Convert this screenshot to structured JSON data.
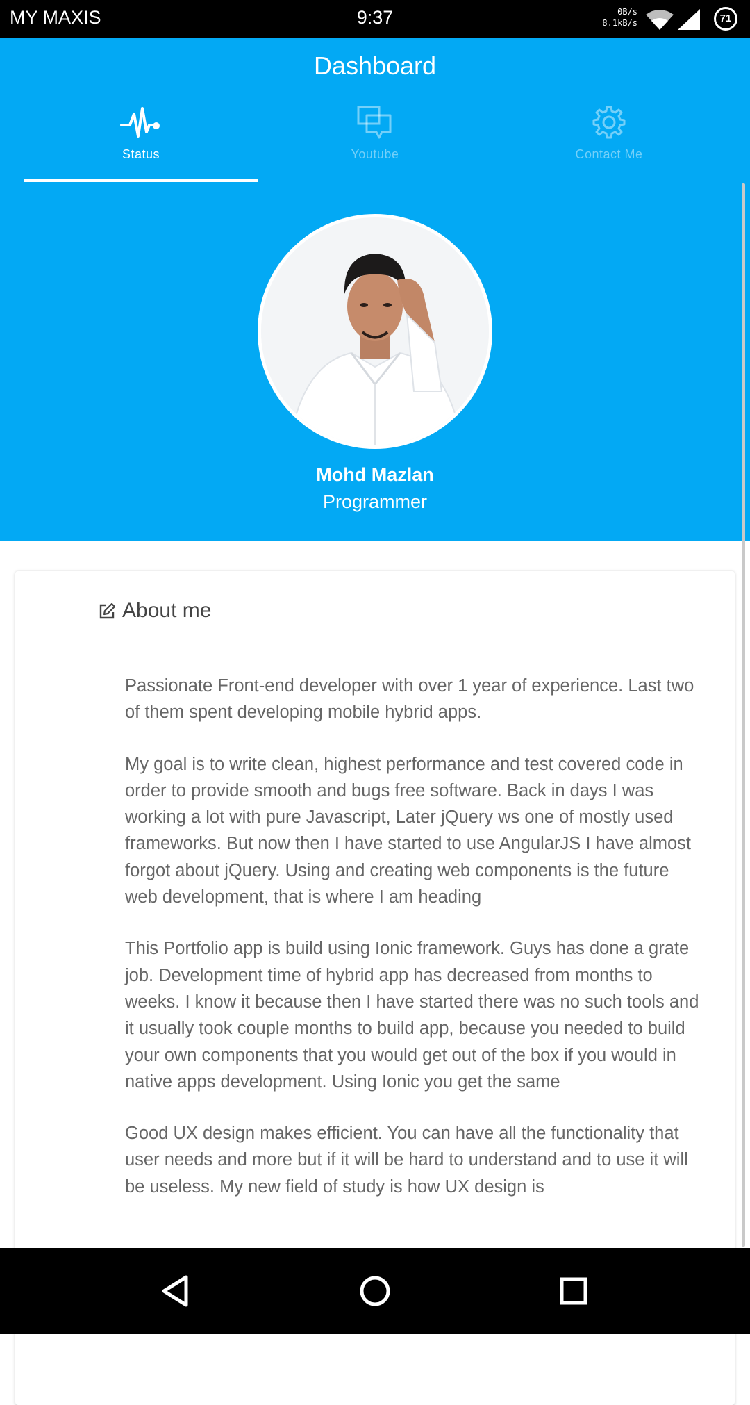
{
  "status_bar": {
    "carrier": "MY MAXIS",
    "time": "9:37",
    "upload_speed": "0B/s",
    "download_speed": "8.1kB/s",
    "battery": "71"
  },
  "header": {
    "title": "Dashboard",
    "tabs": [
      {
        "label": "Status",
        "icon": "pulse-icon",
        "active": true
      },
      {
        "label": "Youtube",
        "icon": "chat-bubbles-icon",
        "active": false
      },
      {
        "label": "Contact Me",
        "icon": "gear-icon",
        "active": false
      }
    ],
    "background_color": "#03a9f4"
  },
  "profile": {
    "name": "Mohd Mazlan",
    "role": "Programmer"
  },
  "about": {
    "title": "About me",
    "icon": "edit-icon",
    "paragraphs": [
      "Passionate Front-end developer with over 1 year of experience. Last two of them spent developing mobile hybrid apps.",
      "My goal is to write clean, highest performance and test covered code in order to provide smooth and bugs free software. Back in days I was working a lot with pure Javascript, Later jQuery ws one of mostly used frameworks. But now then I have started to use AngularJS I have almost forgot about jQuery. Using and creating web components is the future web development, that is where I am heading",
      "This Portfolio app is build using Ionic framework. Guys has done a grate job. Development time of hybrid app has decreased from months to weeks. I know it because then I have started there was no such tools and it usually took couple months to build app, because you needed to build your own components that you would get out of the box if you would in native apps development. Using Ionic you get the same",
      "Good UX design makes efficient. You can have all the functionality that user needs and more but if it will be hard to understand and to use it will be useless. My new field of study is how UX design is"
    ]
  },
  "nav_bar": {
    "buttons": [
      "back-icon",
      "home-icon",
      "recents-icon"
    ]
  }
}
